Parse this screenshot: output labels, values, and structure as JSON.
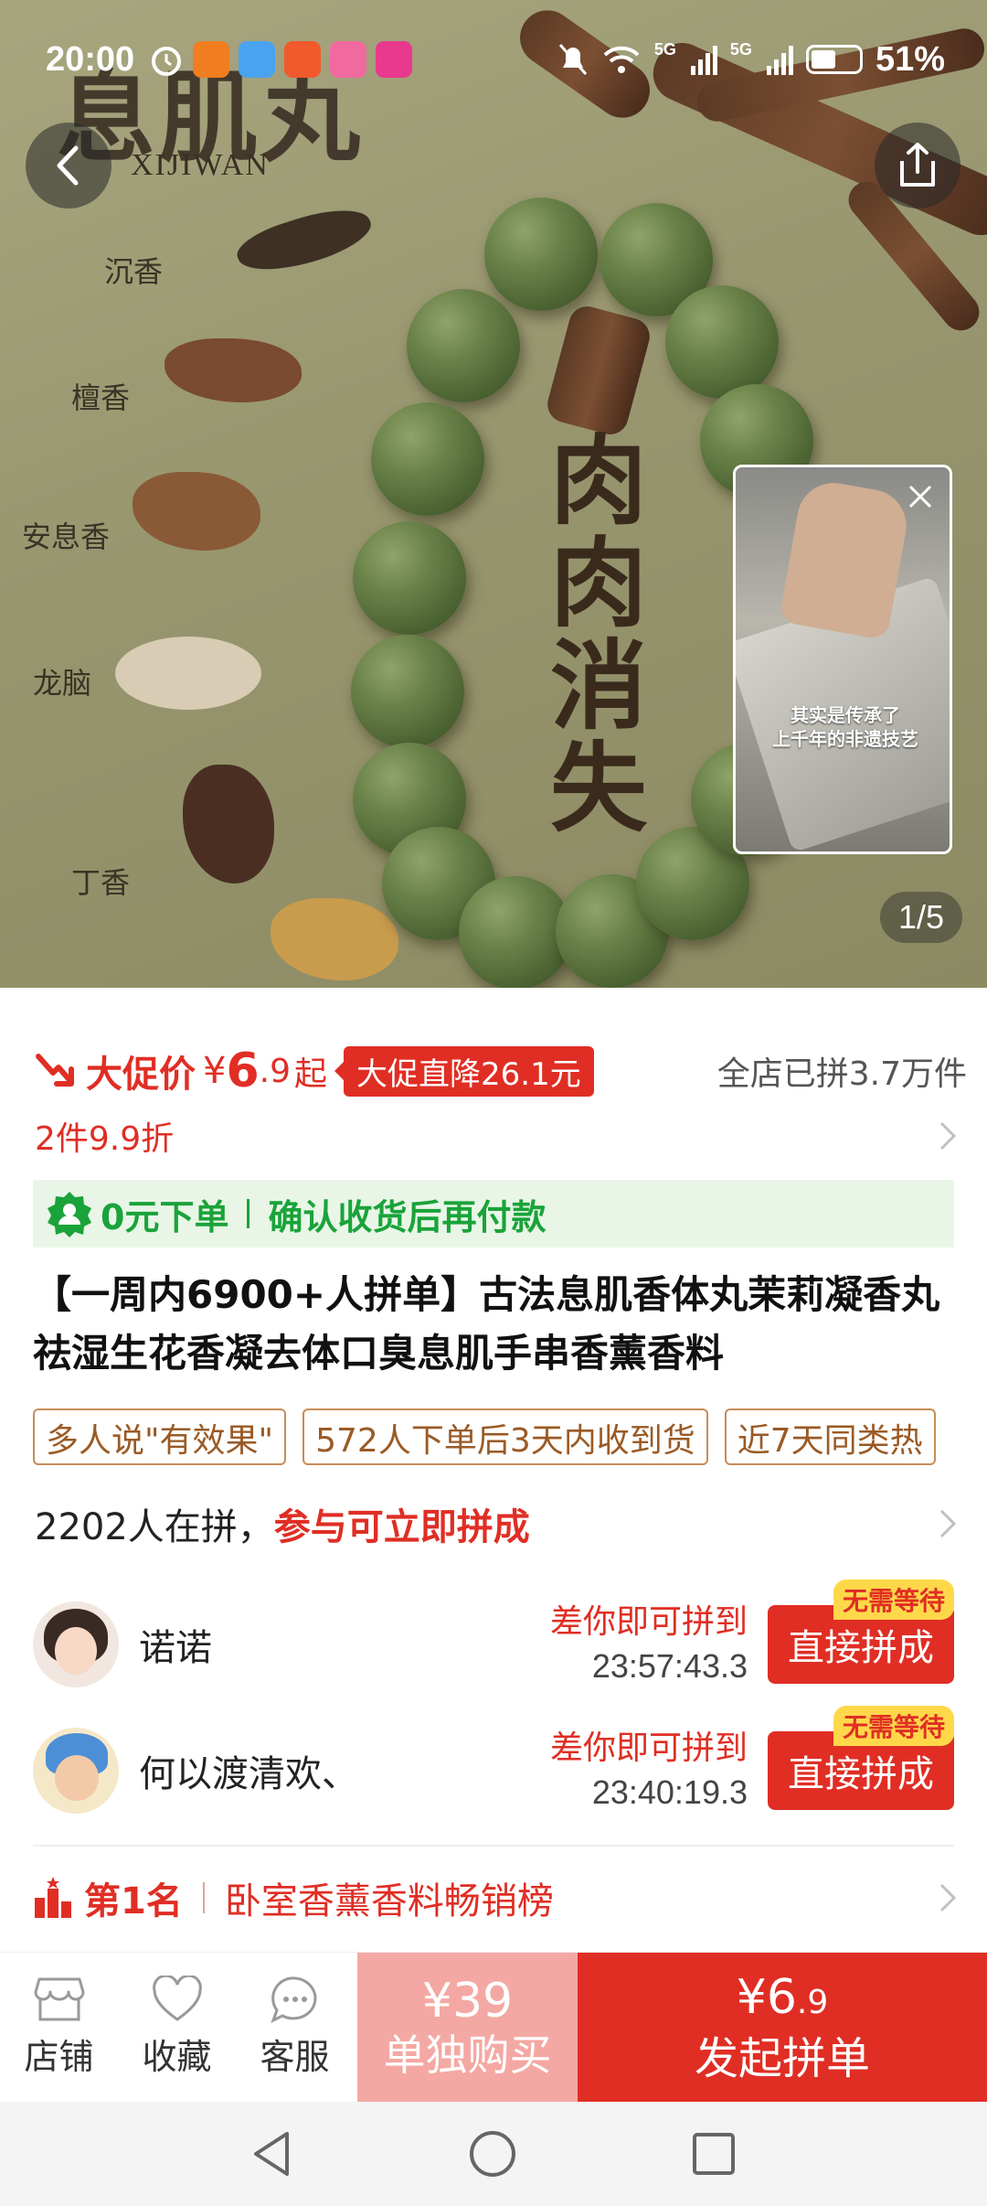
{
  "status_bar": {
    "time": "20:00",
    "net1": "5G",
    "net2": "5G",
    "battery": "51%"
  },
  "hero": {
    "brand": "息肌丸",
    "brand_sub": "XIJIWAN",
    "ingredients": [
      "沉香",
      "檀香",
      "安息香",
      "龙脑",
      "丁香"
    ],
    "headline": [
      "肉",
      "肉",
      "消",
      "失"
    ],
    "video_caption_line1": "其实是传承了",
    "video_caption_line2": "上千年的非遗技艺",
    "page_indicator": "1/5"
  },
  "price": {
    "label": "大促价",
    "currency": "¥",
    "integer": "6",
    "decimal": ".9",
    "suffix": "起",
    "promo_badge": "大促直降26.1元",
    "sold": "全店已拼3.7万件"
  },
  "discount": {
    "text": "2件9.9折"
  },
  "zero_order": {
    "left": "0元下单",
    "right": "确认收货后再付款"
  },
  "product": {
    "title": "【一周内6900+人拼单】古法息肌香体丸茉莉凝香丸祛湿生花香凝去体口臭息肌手串香薰香料"
  },
  "tags": [
    "多人说\"有效果\"",
    "572人下单后3天内收到货",
    "近7天同类热"
  ],
  "group": {
    "count_text": "2202人在拼，",
    "highlight": "参与可立即拼成"
  },
  "members": [
    {
      "name": "诺诺",
      "need": "差你即可拼到",
      "timer": "23:57:43.3",
      "badge": "无需等待",
      "button": "直接拼成"
    },
    {
      "name": "何以渡清欢、",
      "need": "差你即可拼到",
      "timer": "23:40:19.3",
      "badge": "无需等待",
      "button": "直接拼成"
    }
  ],
  "rank": {
    "rank": "第1名",
    "title": "卧室香薰香料畅销榜"
  },
  "bottom_bar": {
    "shop": "店铺",
    "favorite": "收藏",
    "service": "客服",
    "single_price": "¥39",
    "single_label": "单独购买",
    "group_price_int": "¥6",
    "group_price_dec": ".9",
    "group_label": "发起拼单"
  },
  "colors": {
    "accent": "#e02e24",
    "green": "#1aa33a",
    "single_bg": "#f4a8a3"
  }
}
